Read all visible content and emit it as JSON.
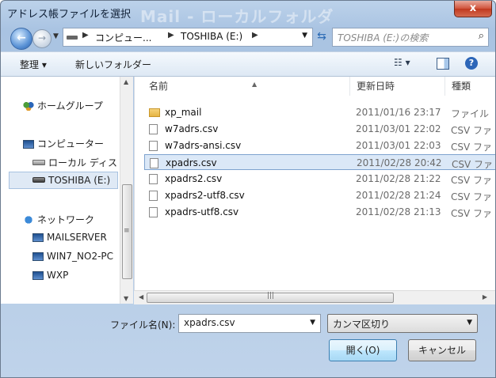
{
  "window": {
    "title": "アドレス帳ファイルを選択",
    "background_text": "Mail - ローカルフォルダ",
    "close_label": "x"
  },
  "nav": {
    "back_glyph": "←",
    "forward_glyph": "→",
    "breadcrumb": [
      "コンピュー...",
      "TOSHIBA (E:)"
    ],
    "search_placeholder": "TOSHIBA (E:)の検索"
  },
  "toolbar": {
    "organize_label": "整理 ▾",
    "new_folder_label": "新しいフォルダー",
    "view_label": "☷ ▾",
    "help_label": "?"
  },
  "sidebar": {
    "items": [
      {
        "label": "ホームグループ"
      },
      {
        "label": "コンピューター"
      },
      {
        "label": "ローカル ディス"
      },
      {
        "label": "TOSHIBA (E:)"
      },
      {
        "label": "ネットワーク"
      },
      {
        "label": "MAILSERVER"
      },
      {
        "label": "WIN7_NO2-PC"
      },
      {
        "label": "WXP"
      }
    ]
  },
  "columns": {
    "name": "名前",
    "date": "更新日時",
    "type": "種類"
  },
  "files": [
    {
      "name": "xp_mail",
      "date": "2011/01/16 23:17",
      "type": "ファイル",
      "folder": true
    },
    {
      "name": "w7adrs.csv",
      "date": "2011/03/01 22:02",
      "type": "CSV ファ"
    },
    {
      "name": "w7adrs-ansi.csv",
      "date": "2011/03/01 22:03",
      "type": "CSV ファ"
    },
    {
      "name": "xpadrs.csv",
      "date": "2011/02/28 20:42",
      "type": "CSV ファ",
      "selected": true
    },
    {
      "name": "xpadrs2.csv",
      "date": "2011/02/28 21:22",
      "type": "CSV ファ"
    },
    {
      "name": "xpadrs2-utf8.csv",
      "date": "2011/02/28 21:24",
      "type": "CSV ファ"
    },
    {
      "name": "xpadrs-utf8.csv",
      "date": "2011/02/28 21:13",
      "type": "CSV ファ"
    }
  ],
  "footer": {
    "filename_label": "ファイル名(N):",
    "filename_value": "xpadrs.csv",
    "filter_value": "カンマ区切り",
    "open_label": "開く(O)",
    "cancel_label": "キャンセル"
  }
}
